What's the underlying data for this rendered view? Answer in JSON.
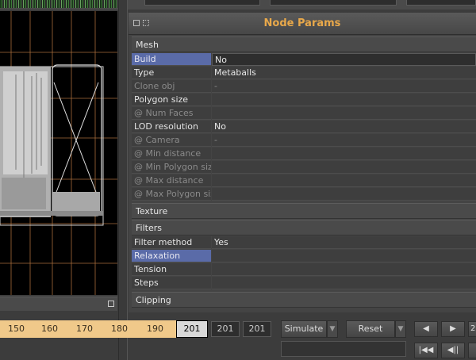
{
  "panel": {
    "title": "Node Params",
    "sections": {
      "mesh": "Mesh",
      "texture": "Texture",
      "filters": "Filters",
      "clipping": "Clipping"
    },
    "mesh_rows": [
      {
        "label": "Build",
        "value": "No"
      },
      {
        "label": "Type",
        "value": "Metaballs"
      },
      {
        "label": "Clone obj",
        "value": "-"
      },
      {
        "label": "Polygon size",
        "value": ""
      },
      {
        "label": "@ Num Faces",
        "value": ""
      },
      {
        "label": "LOD resolution",
        "value": "No"
      },
      {
        "label": "@ Camera",
        "value": "-"
      },
      {
        "label": "@ Min distance",
        "value": ""
      },
      {
        "label": "@ Min Polygon size",
        "value": ""
      },
      {
        "label": "@ Max distance",
        "value": ""
      },
      {
        "label": "@ Max Polygon size",
        "value": ""
      }
    ],
    "filter_rows": [
      {
        "label": "Filter method",
        "value": "Yes"
      },
      {
        "label": "Relaxation",
        "value": ""
      },
      {
        "label": "Tension",
        "value": ""
      },
      {
        "label": "Steps",
        "value": ""
      }
    ]
  },
  "timeline": {
    "ticks": [
      "150",
      "160",
      "170",
      "180",
      "190"
    ],
    "current_frame": "201",
    "start_frame": "201",
    "end_frame": "201"
  },
  "controls": {
    "simulate": "Simulate",
    "reset": "Reset",
    "arrow_down": "▼",
    "prev": "◀",
    "play": "▶",
    "first": "|◀◀",
    "step_back": "◀||",
    "partial_digit": "2"
  },
  "colors": {
    "title": "#e8a84a",
    "selected_row": "#5a6ba8",
    "timeline": "#f0c98a"
  }
}
